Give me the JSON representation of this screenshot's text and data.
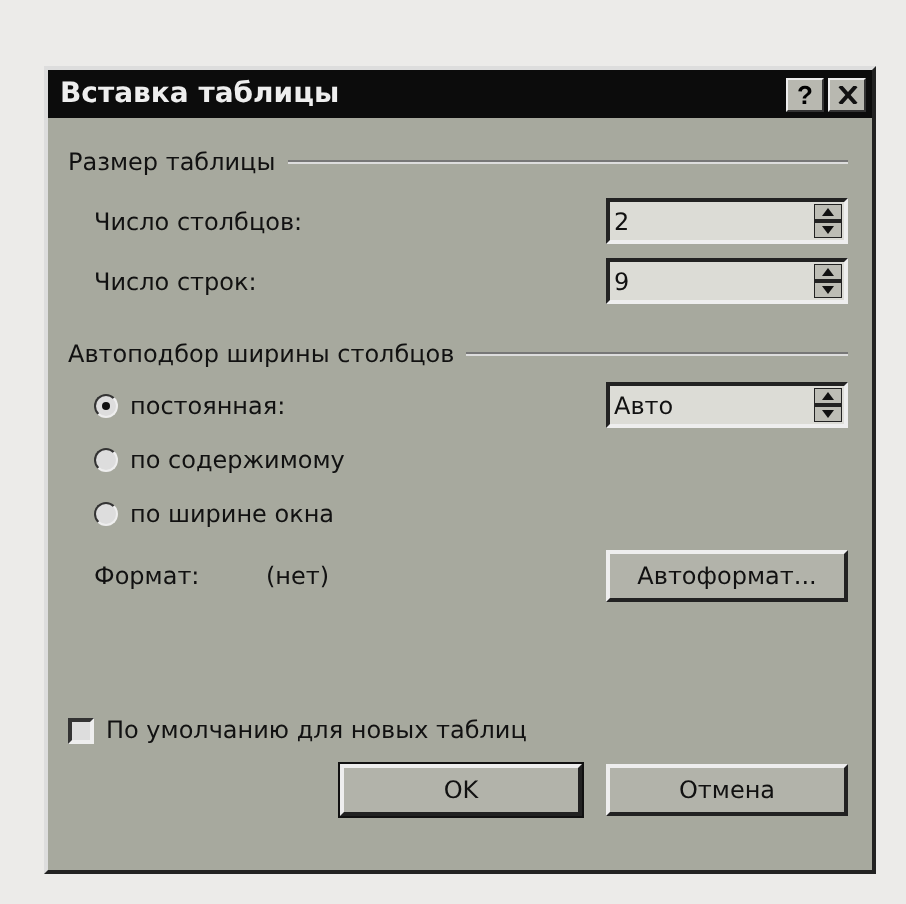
{
  "window": {
    "title": "Вставка таблицы",
    "help": "?"
  },
  "table_size": {
    "label": "Размер таблицы",
    "fields": [
      {
        "label": "Число столбцов:",
        "value": "2"
      },
      {
        "label": "Число строк:",
        "value": "9"
      }
    ]
  },
  "autofit": {
    "label": "Автоподбор ширины столбцов",
    "options": [
      {
        "label": "постоянная:",
        "selected": true,
        "value": "Авто"
      },
      {
        "label": "по содержимому",
        "selected": false
      },
      {
        "label": "по ширине окна",
        "selected": false
      }
    ]
  },
  "format": {
    "label": "Формат:",
    "value": "(нет)",
    "button": "Автоформат..."
  },
  "default_checkbox": {
    "label": "По умолчанию для новых таблиц",
    "checked": false
  },
  "buttons": [
    {
      "label": "OK",
      "kind": "default"
    },
    {
      "label": "Отмена",
      "kind": "normal"
    }
  ]
}
